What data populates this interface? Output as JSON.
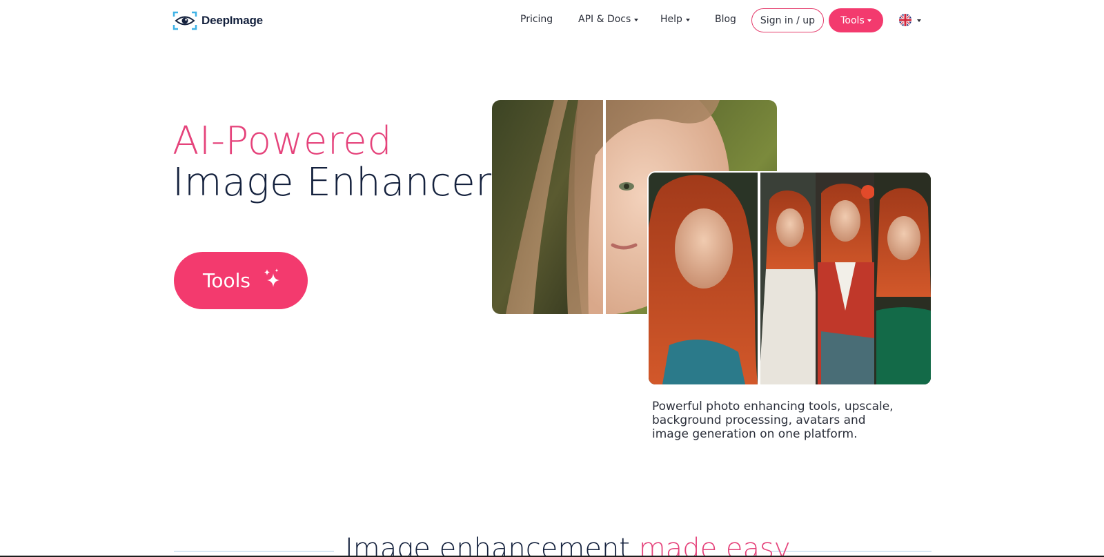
{
  "nav": {
    "logo_text": "DeepImage",
    "links": [
      {
        "label": "Pricing"
      },
      {
        "label": "API & Docs"
      },
      {
        "label": "Help"
      },
      {
        "label": "Blog"
      }
    ],
    "sign_in_label": "Sign in / up",
    "tools_label": "Tools",
    "language_icon": "uk-flag-icon"
  },
  "hero": {
    "title_accent": "AI-Powered",
    "title_main": "Image Enhancer",
    "cta_label": "Tools",
    "cta_icon": "sparkles-icon",
    "description": "Powerful photo enhancing tools, upscale, background processing, avatars and image generation on one platform."
  },
  "section": {
    "title_main": "Image enhancement ",
    "title_accent": "made easy"
  },
  "colors": {
    "accent": "#f33a6e",
    "accent_text": "#e5437b",
    "text_dark": "#14213d"
  }
}
